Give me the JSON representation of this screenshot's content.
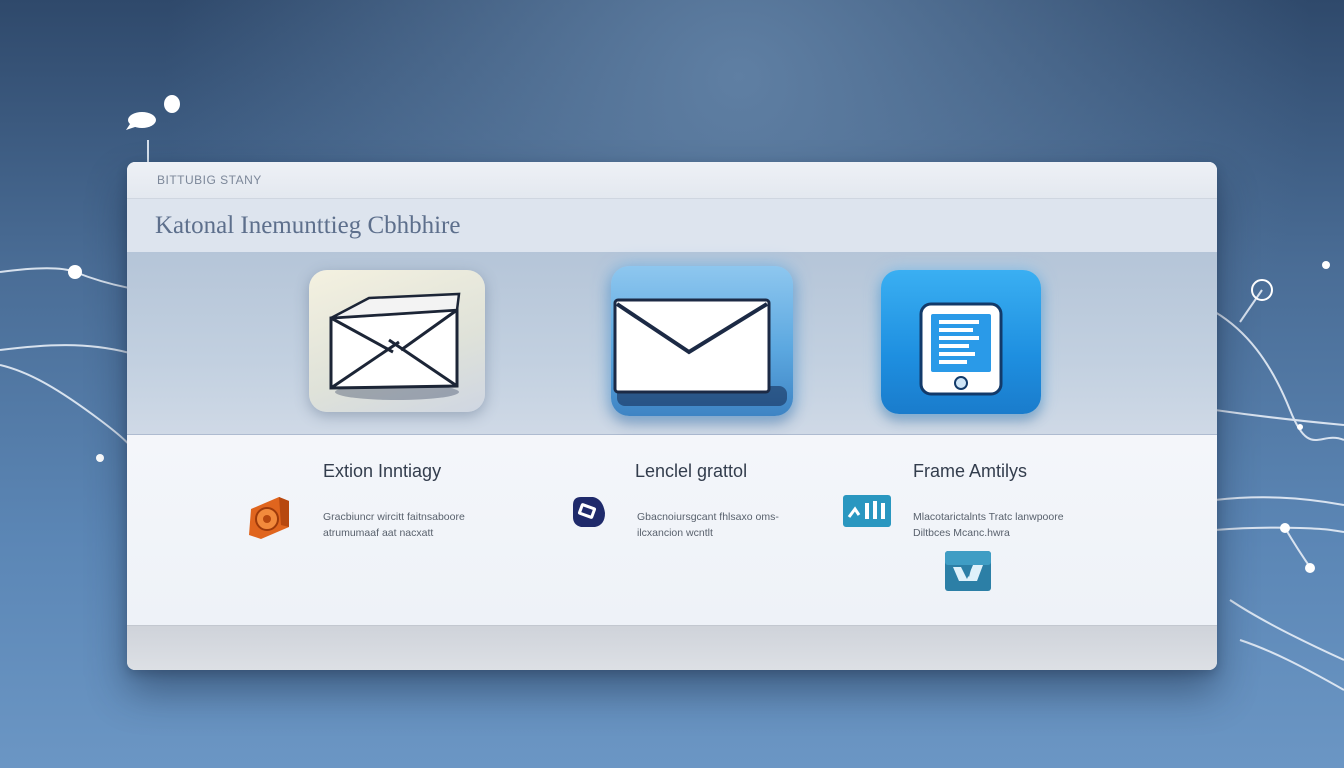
{
  "window": {
    "top_label": "BITTUBIG STANY",
    "title": "Katonal Inemunttieg Cbhbhire"
  },
  "icons": [
    {
      "name": "envelope-open-icon"
    },
    {
      "name": "envelope-icon"
    },
    {
      "name": "smartphone-icon"
    }
  ],
  "features": [
    {
      "heading": "Extion Inntiagy",
      "description_line1": "Gracbiuncr wircitt faitnsaboore",
      "description_line2": "atrumumaaf aat nacxatt",
      "icon": "orange-gear-icon"
    },
    {
      "heading": "Lenclel grattol",
      "description_line1": "Gbacnoiursgcant fhlsaxo oms-",
      "description_line2": "ilcxancion wcntlt",
      "icon": "navy-tag-icon"
    },
    {
      "heading": "Frame Amtilys",
      "description_line1": "Mlacotarictalnts Tratc lanwpoore",
      "description_line2": "Diltbces Mcanc.hwra",
      "icon": "teal-chart-icon",
      "extra_icon": "teal-image-icon"
    }
  ],
  "colors": {
    "accent_blue": "#1e8fe0",
    "tile_blue": "#5ca8e0",
    "orange": "#e0651e",
    "navy": "#1f2a6b",
    "teal": "#2a97c0"
  }
}
